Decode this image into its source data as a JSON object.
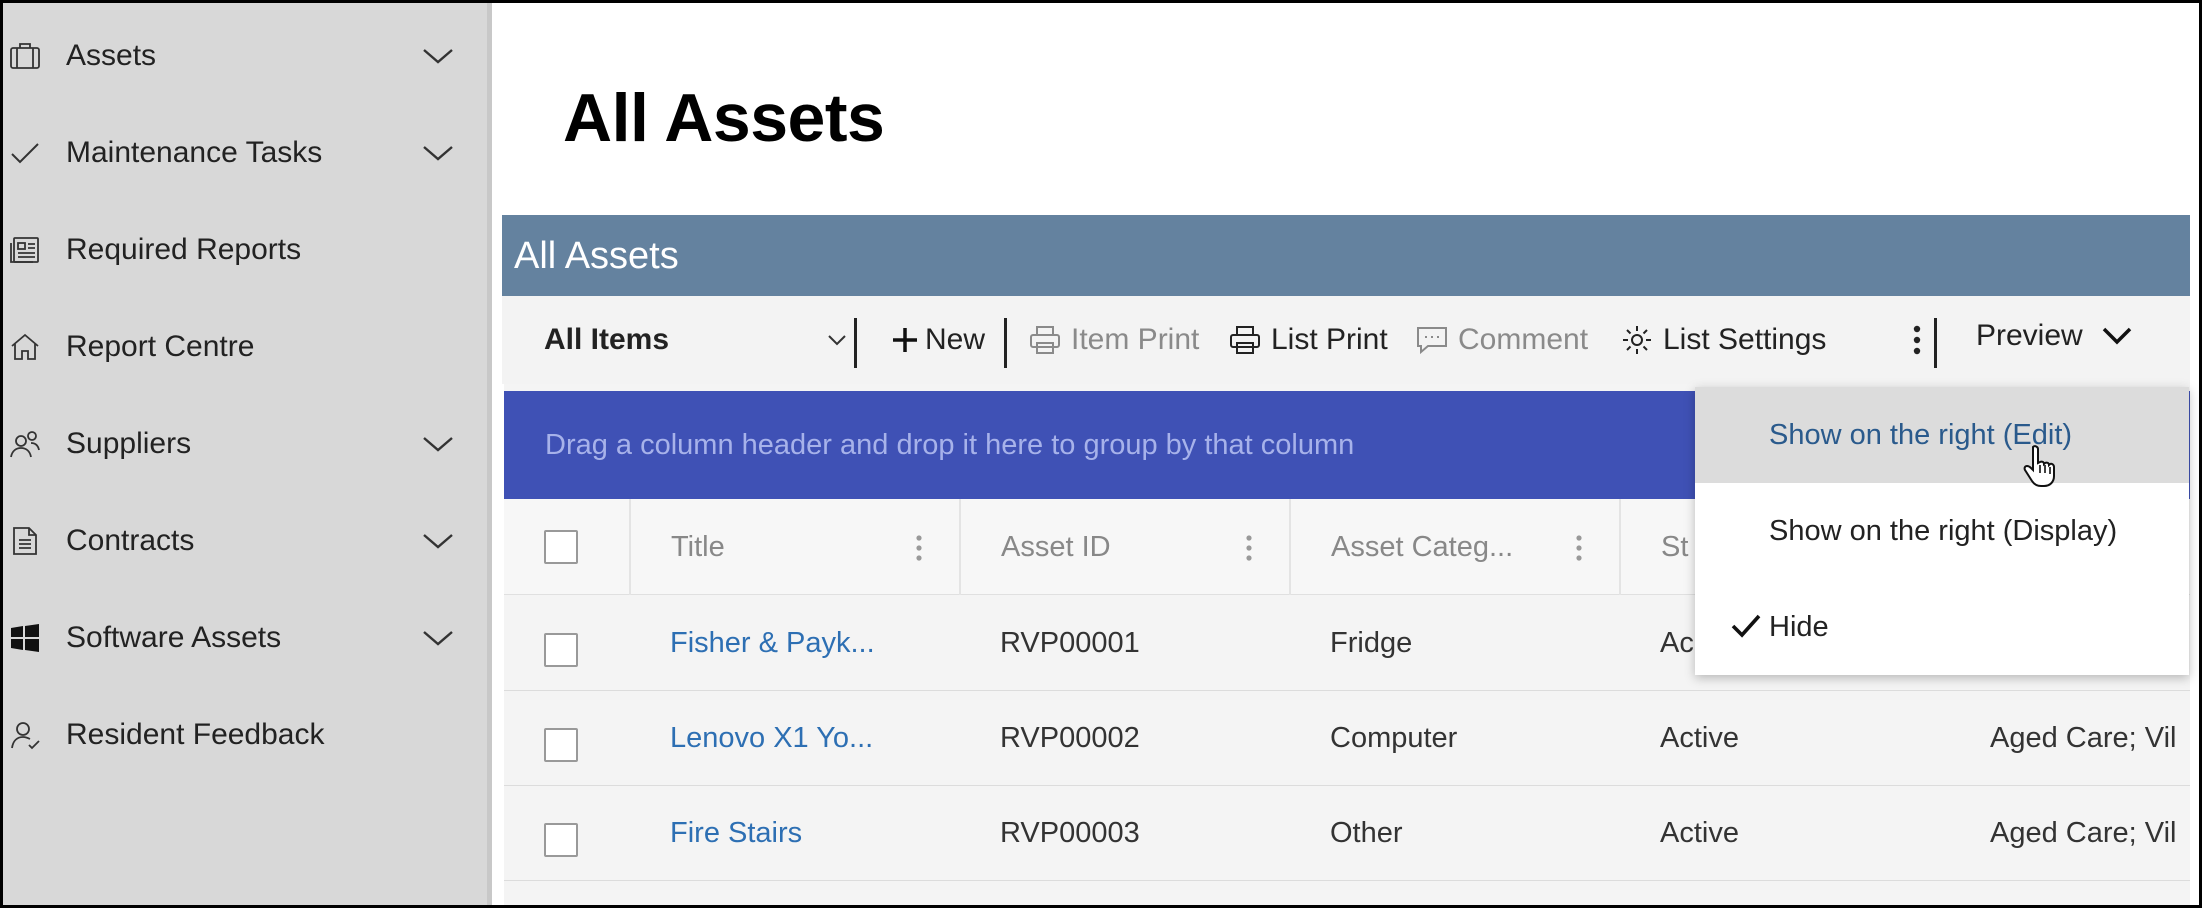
{
  "sidebar": {
    "items": [
      {
        "label": "Assets",
        "icon": "briefcase-icon",
        "expandable": true
      },
      {
        "label": "Maintenance Tasks",
        "icon": "checkmark-icon",
        "expandable": true
      },
      {
        "label": "Required Reports",
        "icon": "report-icon",
        "expandable": false
      },
      {
        "label": "Report Centre",
        "icon": "home-icon",
        "expandable": false
      },
      {
        "label": "Suppliers",
        "icon": "people-icon",
        "expandable": true
      },
      {
        "label": "Contracts",
        "icon": "document-icon",
        "expandable": true
      },
      {
        "label": "Software Assets",
        "icon": "windows-icon",
        "expandable": true
      },
      {
        "label": "Resident Feedback",
        "icon": "person-feedback-icon",
        "expandable": false
      }
    ]
  },
  "page": {
    "title": "All Assets"
  },
  "list": {
    "header_title": "All Assets"
  },
  "toolbar": {
    "view_selector": "All Items",
    "new_label": "New",
    "item_print_label": "Item Print",
    "list_print_label": "List Print",
    "comment_label": "Comment",
    "list_settings_label": "List Settings",
    "preview_label": "Preview"
  },
  "grid": {
    "group_band_text": "Drag a column header and drop it here to group by that column",
    "columns": [
      "Title",
      "Asset ID",
      "Asset Categ...",
      "St"
    ],
    "rows": [
      {
        "title": "Fisher & Payk...",
        "asset_id": "RVP00001",
        "category": "Fridge",
        "status": "Ac",
        "extra": ""
      },
      {
        "title": "Lenovo X1 Yo...",
        "asset_id": "RVP00002",
        "category": "Computer",
        "status": "Active",
        "extra": "Aged Care; Vil"
      },
      {
        "title": "Fire Stairs",
        "asset_id": "RVP00003",
        "category": "Other",
        "status": "Active",
        "extra": "Aged Care; Vil"
      }
    ]
  },
  "preview_menu": {
    "items": [
      {
        "label": "Show on the right (Edit)",
        "checked": false,
        "hovered": true
      },
      {
        "label": "Show on the right (Display)",
        "checked": false,
        "hovered": false
      },
      {
        "label": "Hide",
        "checked": true,
        "hovered": false
      }
    ]
  },
  "colors": {
    "list_header": "#64829f",
    "group_band": "#3f51b5",
    "link": "#2d6fb3",
    "sidebar": "#d8d8d8"
  }
}
